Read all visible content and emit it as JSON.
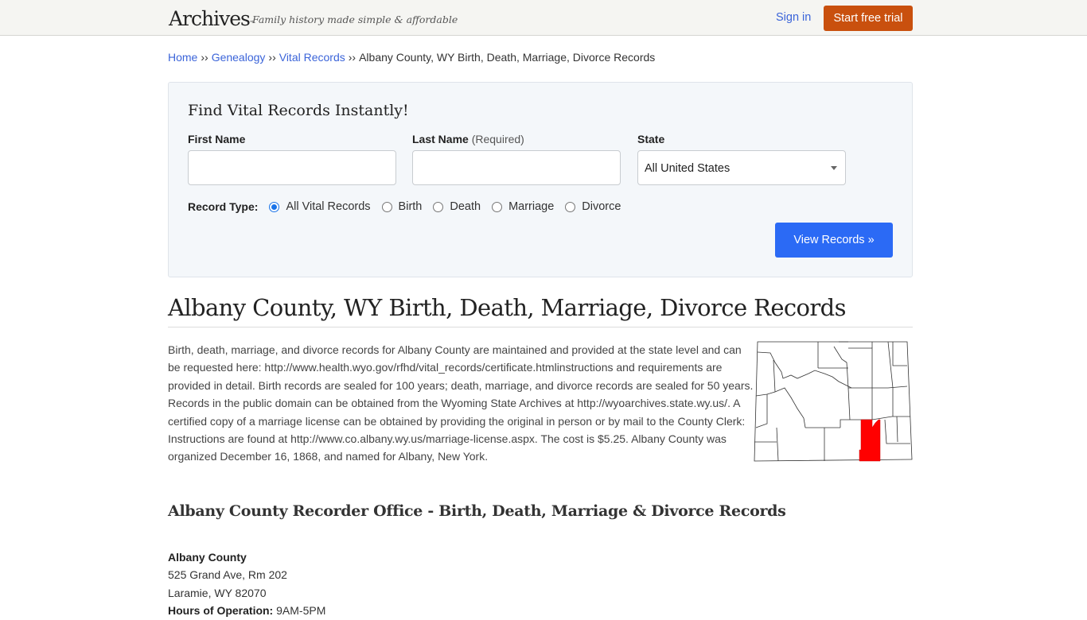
{
  "header": {
    "logo": "Archives",
    "logo_tm": "™",
    "tagline": "Family history made simple & affordable",
    "signin_label": "Sign in",
    "trial_label": "Start free trial",
    "colors": {
      "trial_button": "#c9500e",
      "link": "#3b64d9"
    }
  },
  "breadcrumb": {
    "items": [
      "Home",
      "Genealogy",
      "Vital Records"
    ],
    "separator": "››",
    "current": "Albany County, WY Birth, Death, Marriage, Divorce Records"
  },
  "search": {
    "title": "Find Vital Records Instantly!",
    "first_name_label": "First Name",
    "first_name_value": "",
    "last_name_label": "Last Name",
    "last_name_note": "(Required)",
    "last_name_value": "",
    "state_label": "State",
    "state_value": "All United States",
    "record_type_label": "Record Type:",
    "record_types": [
      {
        "label": "All Vital Records",
        "checked": true
      },
      {
        "label": "Birth",
        "checked": false
      },
      {
        "label": "Death",
        "checked": false
      },
      {
        "label": "Marriage",
        "checked": false
      },
      {
        "label": "Divorce",
        "checked": false
      }
    ],
    "submit_label": "View Records »",
    "colors": {
      "submit_button": "#2b6af5"
    }
  },
  "main": {
    "title": "Albany County, WY Birth, Death, Marriage, Divorce Records",
    "intro": "Birth, death, marriage, and divorce records for Albany County are maintained and provided at the state level and can be requested here: http://www.health.wyo.gov/rfhd/vital_records/certificate.htmlinstructions and requirements are provided in detail. Birth records are sealed for 100 years; death, marriage, and divorce records are sealed for 50 years. Records in the public domain can be obtained from the Wyoming State Archives at http://wyoarchives.state.wy.us/. A certified copy of a marriage license can be obtained by providing the original in person or by mail to the County Clerk: Instructions are found at http://www.co.albany.wy.us/marriage-license.aspx. The cost is $5.25. Albany County was organized December 16, 1868, and named for Albany, New York.",
    "map": {
      "state": "Wyoming",
      "highlighted_county": "Albany County",
      "highlight_color": "#ff0000"
    },
    "section_title": "Albany County Recorder Office - Birth, Death, Marriage & Divorce Records",
    "office": {
      "name": "Albany County",
      "address1": "525 Grand Ave, Rm 202",
      "address2": "Laramie, WY 82070",
      "hours_label": "Hours of Operation:",
      "hours_value": "9AM-5PM"
    }
  }
}
